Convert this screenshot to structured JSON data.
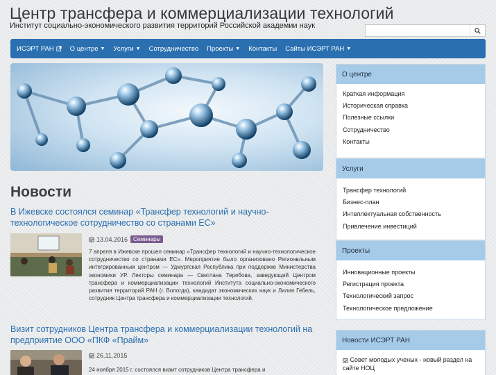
{
  "header": {
    "title": "Центр трансфера и коммерциализации технологий",
    "subtitle": "Институт социально-экономического развития территорий Российской академии наук"
  },
  "search": {
    "placeholder": "",
    "icon": "search-icon"
  },
  "nav": {
    "items": [
      {
        "label": "ИСЭРТ РАН",
        "icon": "external-link-icon"
      },
      {
        "label": "О центре",
        "dropdown": true
      },
      {
        "label": "Услуги",
        "dropdown": true
      },
      {
        "label": "Сотрудничество"
      },
      {
        "label": "Проекты",
        "dropdown": true
      },
      {
        "label": "Контакты"
      },
      {
        "label": "Сайты ИСЭРТ РАН",
        "dropdown": true
      }
    ]
  },
  "main": {
    "news_heading": "Новости",
    "articles": [
      {
        "title": "В Ижевске состоялся семинар «Трансфер технологий и научно-технологическое сотрудничество со странами ЕС»",
        "date": "13.04.2016",
        "tag": "Семинары",
        "text": "7 апреля в Ижевске прошел семинар «Трансфер технологий и научно-технологическое сотрудничество со странами ЕС». Мероприятие было организовано Регионвльным интегрированным центром — Удмуртская Республика при поддержке Министерства экономики УР. Лекторы семинара — Светлана Теребова, заведующий Центром трансфера и коммерциализации технологий Института социально-экономического развития территорий РАН (г. Вологда), кандидат экономических наук и Лилия Гебель, сотрудник Центра трансфера и коммерциализации технологий."
      },
      {
        "title": "Визит сотрудников Центра трансфера и коммерциализации технологий на предприятие ООО «ПКФ «Прайм»",
        "date": "26.11.2015",
        "text": "24 ноября 2015 г. состоялся визит сотрудников Центра трансфера и"
      }
    ]
  },
  "sidebar": {
    "panels": [
      {
        "title": "О центре",
        "links": [
          "Краткая информация",
          "Историческая справка",
          "Полезные ссылки",
          "Сотрудничество",
          "Контакты"
        ]
      },
      {
        "title": "Услуги",
        "links": [
          "Трансфер технологий",
          "Бизнес-план",
          "Интеллектуальная собственность",
          "Привлечение инвестиций"
        ]
      },
      {
        "title": "Проекты",
        "links": [
          "Инновационные проекты",
          "Регистрация проекта",
          "Технологический запрос",
          "Технологическое предложение"
        ]
      },
      {
        "title": "Новости ИСЭРТ РАН",
        "links": [
          "Совет молодых ученых - новый раздел на сайте НОЦ"
        ]
      }
    ]
  },
  "colors": {
    "nav_bg": "#2a6fb0",
    "panel_head": "#a6cbe9",
    "link": "#2a6fb0",
    "badge": "#7a5a8f"
  }
}
